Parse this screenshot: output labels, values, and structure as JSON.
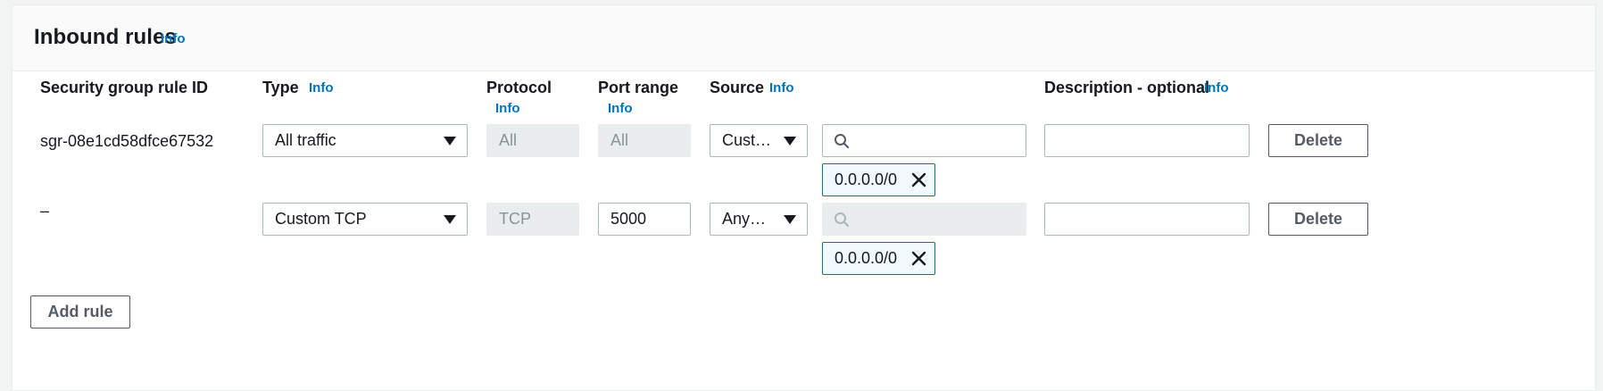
{
  "section": {
    "title": "Inbound rules",
    "info": "Info"
  },
  "columns": {
    "rule_id": "Security group rule ID",
    "type": "Type",
    "protocol": "Protocol",
    "port_range": "Port range",
    "source": "Source",
    "description": "Description - optional",
    "info": "Info"
  },
  "rules": [
    {
      "rule_id": "sgr-08e1cd58dfce67532",
      "type": "All traffic",
      "protocol": "All",
      "port_range": "All",
      "source_type": "Custom",
      "source_search": "",
      "source_token": "0.0.0.0/0",
      "description": "",
      "delete_label": "Delete"
    },
    {
      "rule_id": "–",
      "type": "Custom TCP",
      "protocol": "TCP",
      "port_range": "5000",
      "source_type": "Anywh...",
      "source_search": "",
      "source_token": "0.0.0.0/0",
      "description": "",
      "delete_label": "Delete"
    }
  ],
  "actions": {
    "add_rule": "Add rule"
  },
  "colors": {
    "link": "#0073bb",
    "border": "#aab7b8",
    "disabled_bg": "#eaeded",
    "button_text": "#545b64"
  }
}
